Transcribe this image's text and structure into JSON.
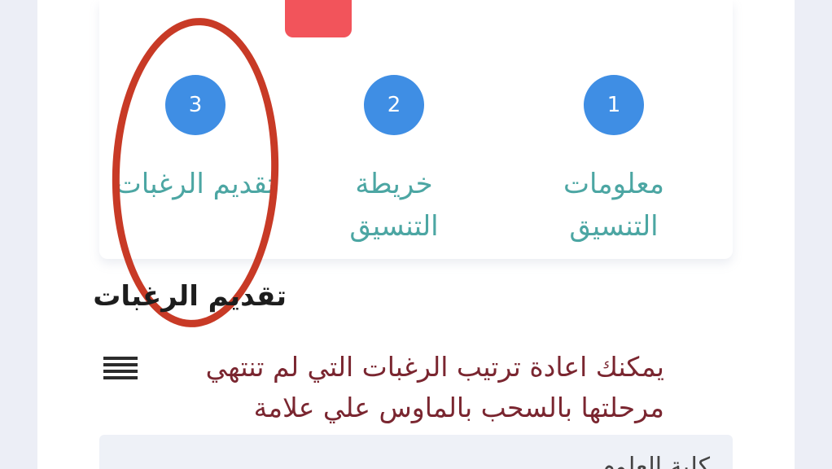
{
  "stepper": {
    "steps": [
      {
        "number": "1",
        "label": "معلومات التنسيق"
      },
      {
        "number": "2",
        "label": "خريطة التنسيق"
      },
      {
        "number": "3",
        "label": "تقديم الرغبات"
      }
    ]
  },
  "section": {
    "title": "تقديم الرغبات"
  },
  "instruction": {
    "text": "يمكنك اعادة ترتيب الرغبات التي لم تنتهي مرحلتها بالسحب بالماوس علي علامة"
  },
  "list": {
    "first_item": "كلية العلوم"
  },
  "icons": {
    "drag": "drag-lines-icon"
  },
  "colors": {
    "step_circle": "#3f8ee4",
    "step_label": "#4ca6a3",
    "highlight_ring": "#c83a26",
    "badge": "#f2545b",
    "instruction_text": "#7a2630"
  }
}
